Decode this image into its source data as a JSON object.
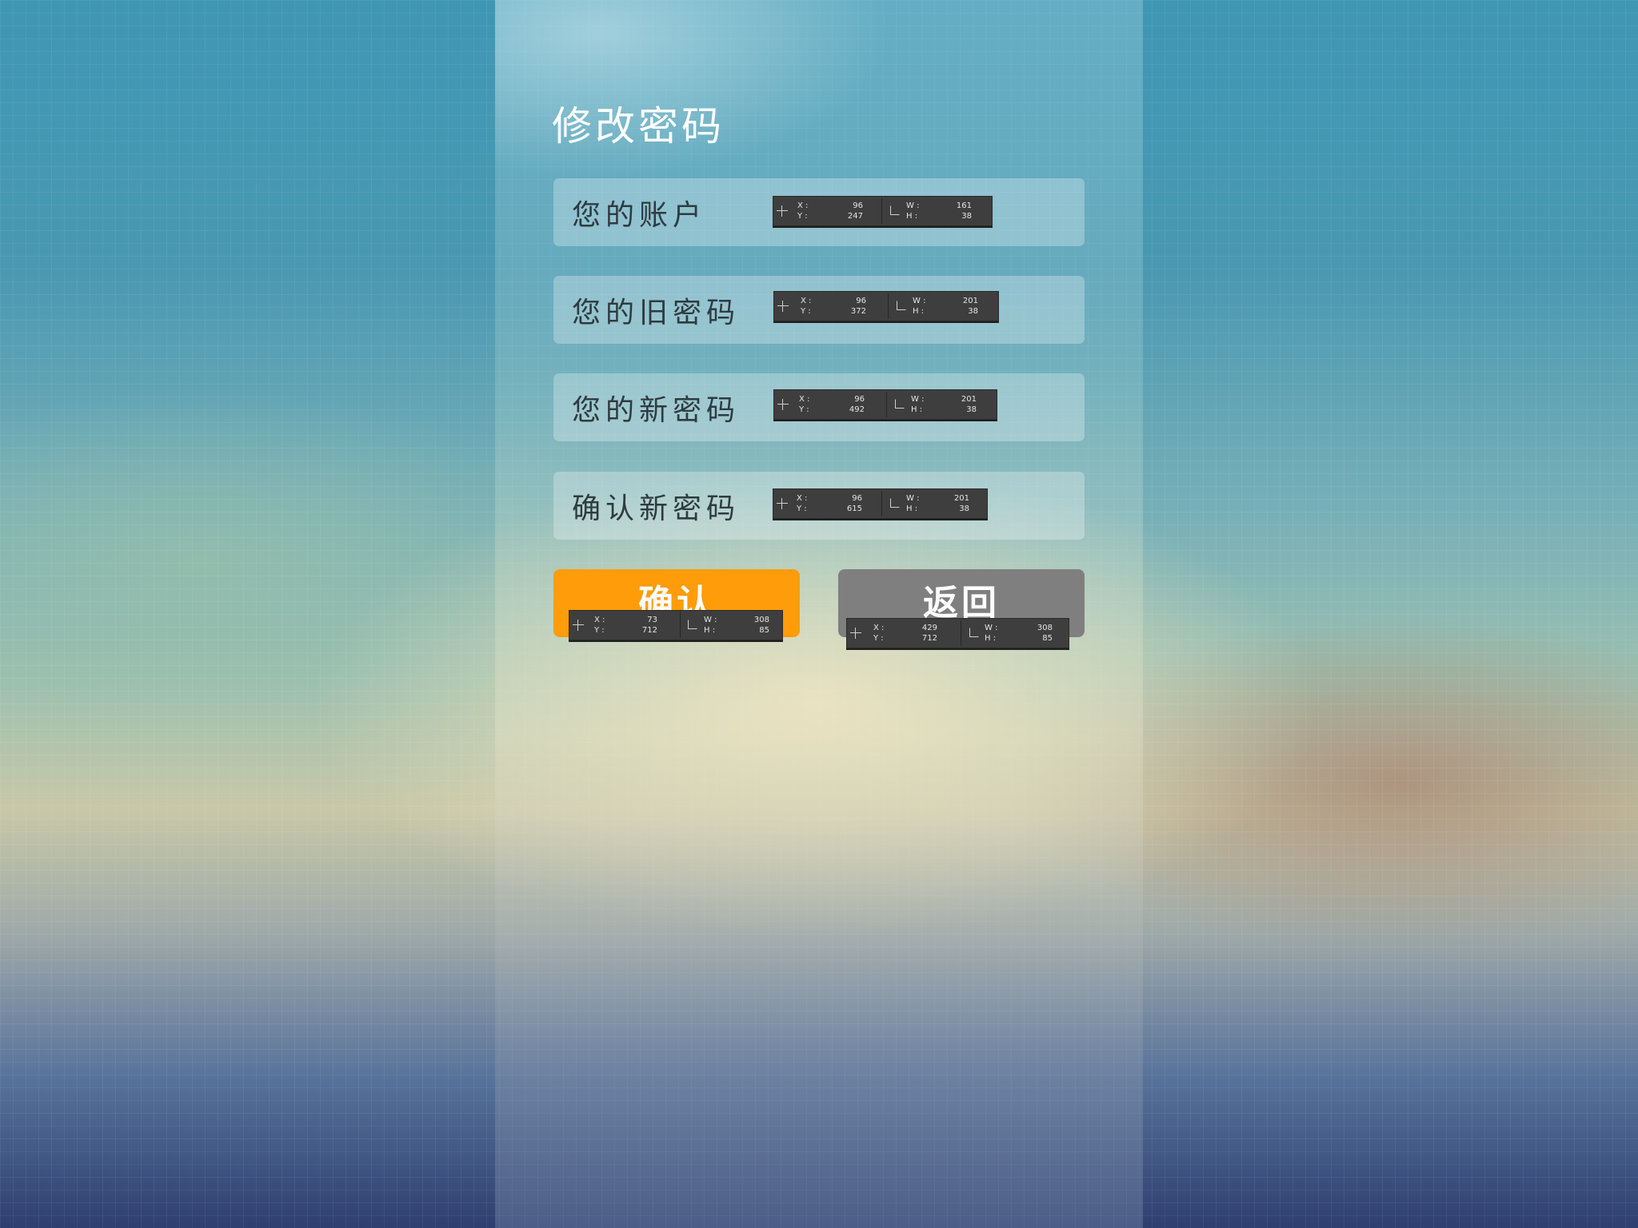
{
  "page": {
    "title": "修改密码"
  },
  "form": {
    "fields": [
      {
        "label": "您的账户",
        "measure": {
          "x_label": "X :",
          "x": "96",
          "y_label": "Y :",
          "y": "247",
          "w_label": "W :",
          "w": "161",
          "h_label": "H :",
          "h": "38"
        }
      },
      {
        "label": "您的旧密码",
        "measure": {
          "x_label": "X :",
          "x": "96",
          "y_label": "Y :",
          "y": "372",
          "w_label": "W :",
          "w": "201",
          "h_label": "H :",
          "h": "38"
        }
      },
      {
        "label": "您的新密码",
        "measure": {
          "x_label": "X :",
          "x": "96",
          "y_label": "Y :",
          "y": "492",
          "w_label": "W :",
          "w": "201",
          "h_label": "H :",
          "h": "38"
        }
      },
      {
        "label": "确认新密码",
        "measure": {
          "x_label": "X :",
          "x": "96",
          "y_label": "Y :",
          "y": "615",
          "w_label": "W :",
          "w": "201",
          "h_label": "H :",
          "h": "38"
        }
      }
    ]
  },
  "buttons": {
    "confirm": {
      "label": "确认",
      "color": "#ff9c0a",
      "measure": {
        "x_label": "X :",
        "x": "73",
        "y_label": "Y :",
        "y": "712",
        "w_label": "W :",
        "w": "308",
        "h_label": "H :",
        "h": "85"
      }
    },
    "back": {
      "label": "返回",
      "color": "#7f7f7f",
      "measure": {
        "x_label": "X :",
        "x": "429",
        "y_label": "Y :",
        "y": "712",
        "w_label": "W :",
        "w": "308",
        "h_label": "H :",
        "h": "85"
      }
    }
  },
  "icons": {
    "measure_position": "crosshair-icon",
    "measure_size": "resize-icon"
  }
}
